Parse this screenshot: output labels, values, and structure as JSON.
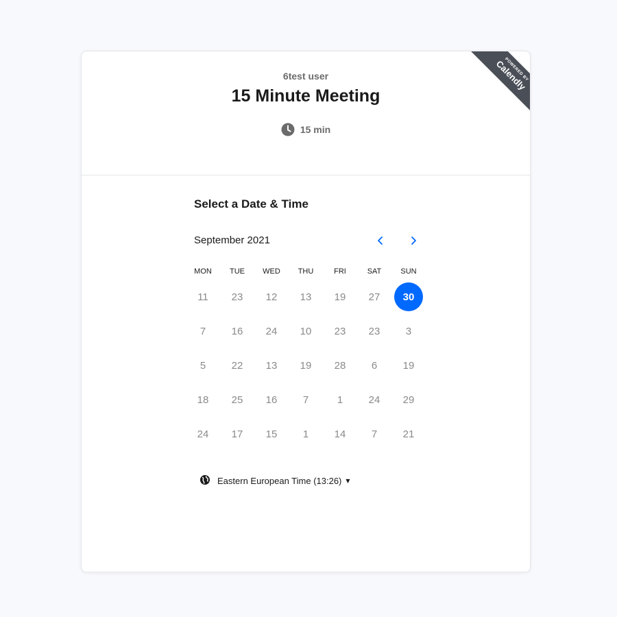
{
  "header": {
    "organizer": "6test user",
    "event_title": "15 Minute Meeting",
    "duration": "15 min",
    "ribbon_small": "POWERED BY",
    "ribbon_brand": "Calendly"
  },
  "scheduler": {
    "section_title": "Select a Date & Time",
    "month": "September 2021",
    "weekdays": [
      "MON",
      "TUE",
      "WED",
      "THU",
      "FRI",
      "SAT",
      "SUN"
    ],
    "weeks": [
      [
        "11",
        "23",
        "12",
        "13",
        "19",
        "27",
        "30"
      ],
      [
        "7",
        "16",
        "24",
        "10",
        "23",
        "23",
        "3"
      ],
      [
        "5",
        "22",
        "13",
        "19",
        "28",
        "6",
        "19"
      ],
      [
        "18",
        "25",
        "16",
        "7",
        "1",
        "24",
        "29"
      ],
      [
        "24",
        "17",
        "15",
        "1",
        "14",
        "7",
        "21"
      ]
    ],
    "selected": {
      "week": 0,
      "day": 6
    },
    "timezone": "Eastern European Time (13:26)"
  },
  "colors": {
    "accent": "#0069ff",
    "ribbon": "#4a4f57",
    "muted_text": "#8a8a8a"
  },
  "icons": {
    "duration": "clock-icon",
    "prev": "chevron-left-icon",
    "next": "chevron-right-icon",
    "timezone": "globe-icon",
    "timezone_dropdown": "caret-down-icon"
  }
}
